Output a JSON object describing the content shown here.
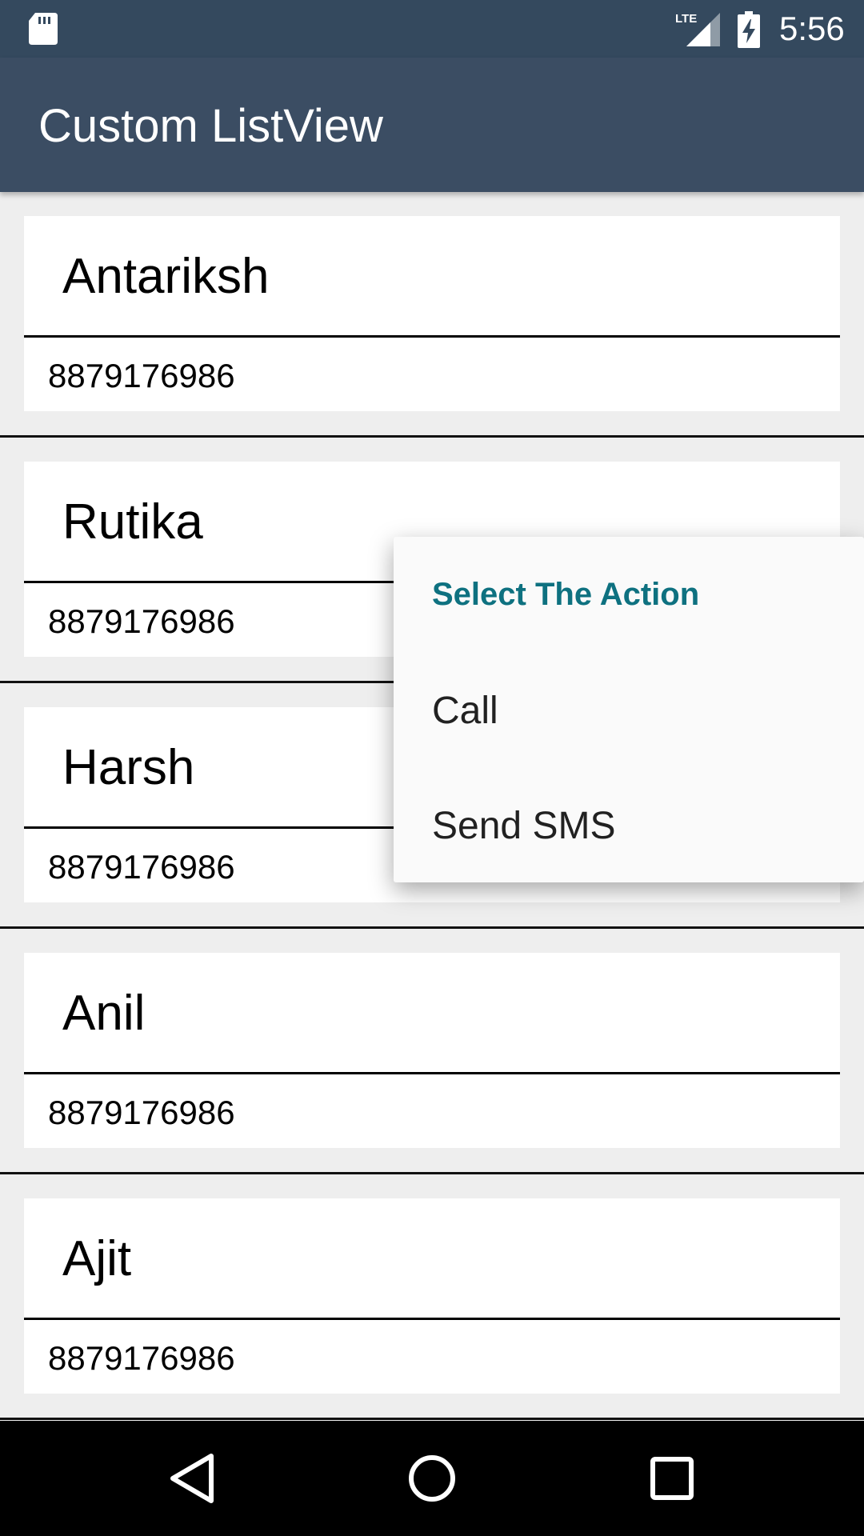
{
  "status_bar": {
    "time": "5:56",
    "network_label": "LTE",
    "icons": [
      "sd-card-icon",
      "lte-signal-icon",
      "battery-charging-icon"
    ]
  },
  "app_bar": {
    "title": "Custom ListView"
  },
  "contacts": [
    {
      "name": "Antariksh",
      "phone": "8879176986"
    },
    {
      "name": "Rutika",
      "phone": "8879176986"
    },
    {
      "name": "Harsh",
      "phone": "8879176986"
    },
    {
      "name": "Anil",
      "phone": "8879176986"
    },
    {
      "name": "Ajit",
      "phone": "8879176986"
    }
  ],
  "context_menu": {
    "title": "Select The Action",
    "items": [
      {
        "label": "Call"
      },
      {
        "label": "Send SMS"
      }
    ]
  },
  "nav_bar": {
    "icons": [
      "back-icon",
      "home-icon",
      "recents-icon"
    ]
  },
  "colors": {
    "status_bar": "#34495e",
    "app_bar": "#3b4d63",
    "menu_title": "#0e7180",
    "list_background": "#eeeeee"
  }
}
